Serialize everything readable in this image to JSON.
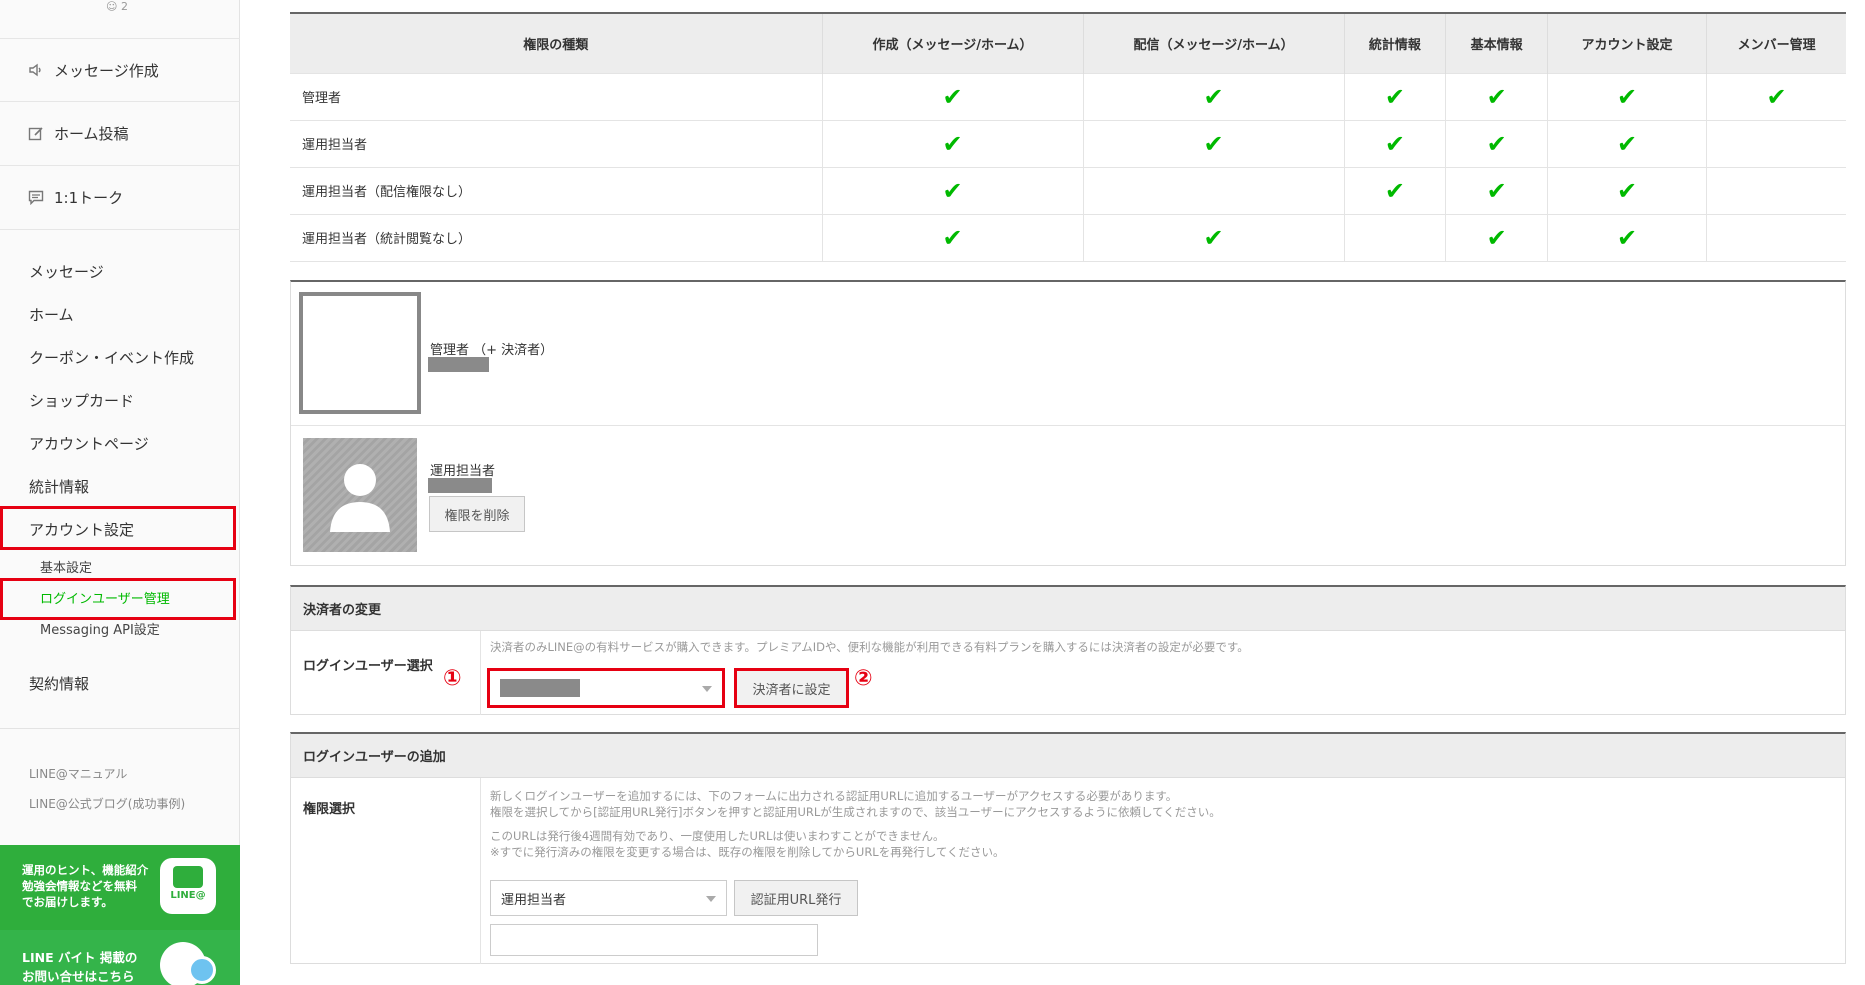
{
  "sidebar": {
    "user_count": "2",
    "quick_actions": {
      "message": "メッセージ作成",
      "home_post": "ホーム投稿",
      "talk": "1:1トーク"
    },
    "nav": {
      "message": "メッセージ",
      "home": "ホーム",
      "coupon": "クーポン・イベント作成",
      "shopcard": "ショップカード",
      "accountpage": "アカウントページ",
      "stats": "統計情報",
      "account_settings": "アカウント設定",
      "contract": "契約情報"
    },
    "subnav": {
      "basic": "基本設定",
      "login_users": "ログインユーザー管理",
      "messaging_api": "Messaging API設定"
    },
    "links": {
      "manual": "LINE@マニュアル",
      "blog": "LINE@公式ブログ(成功事例)"
    },
    "banner1": {
      "line1": "運用のヒント、機能紹介",
      "line2": "勉強会情報などを無料",
      "line3": "でお届けします。",
      "logo": "LINE@",
      "color": "#2fae3c"
    },
    "banner2": {
      "line1": "LINE バイト 掲載の",
      "line2": "お問い合せはこちら",
      "color": "#34b44a"
    }
  },
  "permissions_table": {
    "headers": {
      "type": "権限の種類",
      "create": "作成（メッセージ/ホーム）",
      "deliver": "配信（メッセージ/ホーム）",
      "stats": "統計情報",
      "basic": "基本情報",
      "account": "アカウント設定",
      "members": "メンバー管理"
    },
    "check_mark": "✔",
    "rows": [
      {
        "role": "管理者",
        "checks": [
          true,
          true,
          true,
          true,
          true,
          true
        ]
      },
      {
        "role": "運用担当者",
        "checks": [
          true,
          true,
          true,
          true,
          true,
          false
        ]
      },
      {
        "role": "運用担当者（配信権限なし）",
        "checks": [
          true,
          false,
          true,
          true,
          true,
          false
        ]
      },
      {
        "role": "運用担当者（統計閲覧なし）",
        "checks": [
          true,
          true,
          false,
          true,
          true,
          false
        ]
      }
    ],
    "check_color": "#00b900"
  },
  "members": {
    "admin_role": "管理者 （+ 決済者）",
    "operator_role": "運用担当者",
    "remove_button": "権限を削除"
  },
  "payer": {
    "section_title": "決済者の変更",
    "label": "ログインユーザー選択",
    "note": "決済者のみLINE@の有料サービスが購入できます。プレミアムIDや、便利な機能が利用できる有料プランを購入するには決済者の設定が必要です。",
    "set_button": "決済者に設定",
    "marker1": "①",
    "marker2": "②",
    "highlight_color": "#e60012"
  },
  "add_user": {
    "section_title": "ログインユーザーの追加",
    "label": "権限選択",
    "note1": "新しくログインユーザーを追加するには、下のフォームに出力される認証用URLに追加するユーザーがアクセスする必要があります。",
    "note2": "権限を選択してから[認証用URL発行]ボタンを押すと認証用URLが生成されますので、該当ユーザーにアクセスするように依頼してください。",
    "note3": "このURLは発行後4週間有効であり、一度使用したURLは使いまわすことができません。",
    "note4": "※すでに発行済みの権限を変更する場合は、既存の権限を削除してからURLを再発行してください。",
    "role_select_value": "運用担当者",
    "issue_button": "認証用URL発行"
  }
}
